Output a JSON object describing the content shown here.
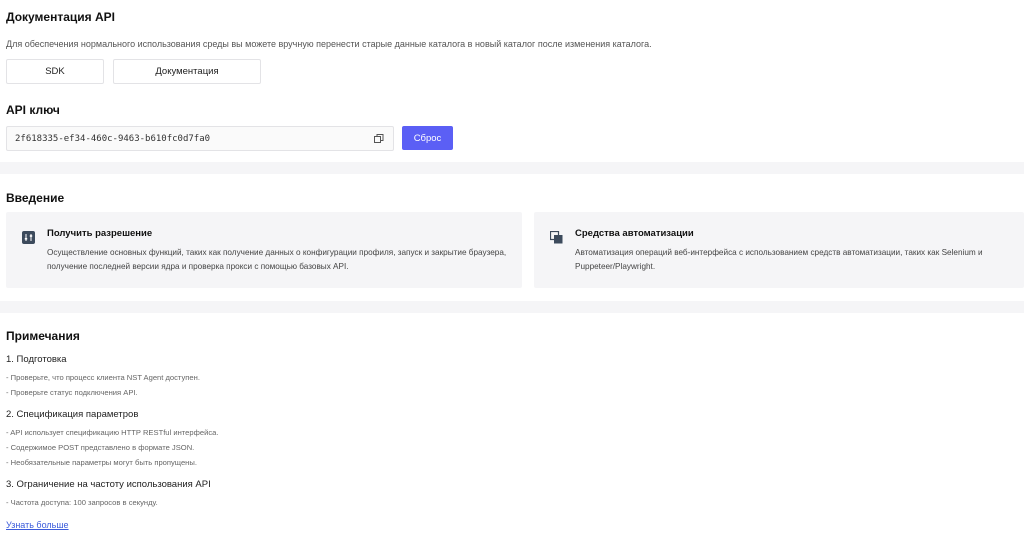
{
  "api_docs": {
    "title": "Документация API",
    "description": "Для обеспечения нормального использования среды вы можете вручную перенести старые данные каталога в новый каталог после изменения каталога.",
    "sdk_button": "SDK",
    "docs_button": "Документация"
  },
  "api_key": {
    "title": "API ключ",
    "value": "2f618335-ef34-460c-9463-b610fc0d7fa0",
    "reset_button": "Сброс"
  },
  "intro": {
    "title": "Введение",
    "cards": [
      {
        "icon": "sliders-icon",
        "title": "Получить разрешение",
        "text": "Осуществление основных функций, таких как получение данных о конфигурации профиля, запуск и закрытие браузера, получение последней версии ядра и проверка прокси с помощью базовых API."
      },
      {
        "icon": "copy-stack-icon",
        "title": "Средства автоматизации",
        "text": "Автоматизация операций веб-интерфейса с использованием средств автоматизации, таких как Selenium и Puppeteer/Playwright."
      }
    ]
  },
  "notes": {
    "title": "Примечания",
    "sections": [
      {
        "head": "1. Подготовка",
        "items": [
          "- Проверьте, что процесс клиента NST Agent доступен.",
          "- Проверьте статус подключения API."
        ]
      },
      {
        "head": "2. Спецификация параметров",
        "items": [
          "- API использует спецификацию HTTP RESTful интерфейса.",
          "- Содержимое POST представлено в формате JSON.",
          "- Необязательные параметры могут быть пропущены."
        ]
      },
      {
        "head": "3. Ограничение на частоту использования API",
        "items": [
          "- Частота доступа: 100 запросов в секунду."
        ]
      }
    ],
    "more_link": "Узнать больше"
  },
  "colors": {
    "accent": "#5b5ff5",
    "link": "#3b5bdb",
    "card_bg": "#f5f5f7"
  }
}
